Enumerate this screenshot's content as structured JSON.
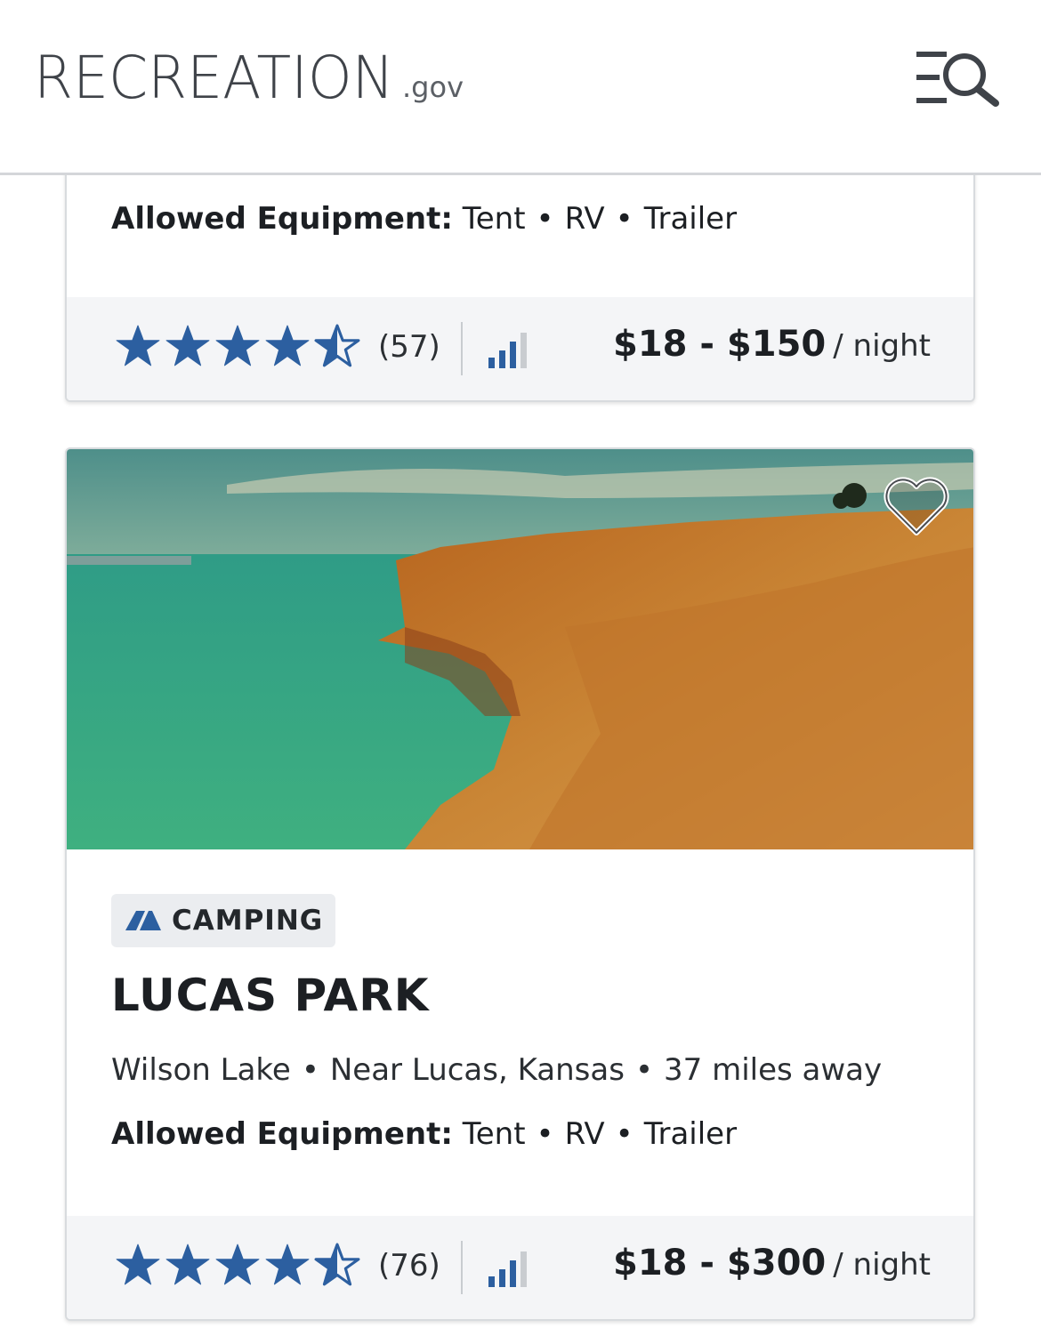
{
  "header": {
    "logo_text": "RECREATION",
    "logo_tld": ".gov"
  },
  "card1": {
    "equipment_label": "Allowed Equipment:",
    "equipment": [
      "Tent",
      "RV",
      "Trailer"
    ],
    "rating": 4.5,
    "rating_count": "(57)",
    "price": "$18 - $150",
    "price_unit": "/ night"
  },
  "card2": {
    "category": "CAMPING",
    "title": "LUCAS PARK",
    "location": [
      "Wilson Lake",
      "Near Lucas, Kansas",
      "37 miles away"
    ],
    "equipment_label": "Allowed Equipment:",
    "equipment": [
      "Tent",
      "RV",
      "Trailer"
    ],
    "rating": 4.5,
    "rating_count": "(76)",
    "price": "$18 - $300",
    "price_unit": "/ night"
  },
  "colors": {
    "star": "#2c5fa0",
    "logo_green": "#5a8a2a",
    "logo_gray": "#3f4349",
    "footer_bg": "#f4f5f7"
  },
  "icons": {
    "menu_search": "menu-search-icon",
    "stars": "star-icon",
    "half_star": "star-half-icon",
    "signal": "cell-signal-icon",
    "favorite": "heart-icon",
    "camping": "tent-icon"
  }
}
